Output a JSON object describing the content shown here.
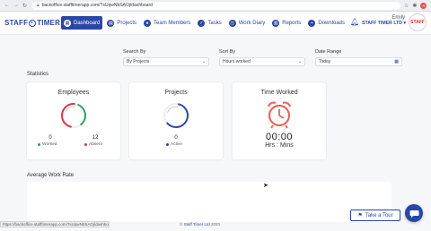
{
  "browser": {
    "url": "backoffice.stafftimerapp.com/?sUqwNbSAOj/dashboard",
    "avatar_letter": "A"
  },
  "header": {
    "logo": {
      "left": "STAFF",
      "right": "TIMER"
    },
    "menu": [
      {
        "label": "Dashboard",
        "icon": "dashboard-icon",
        "glyph": "▦",
        "active": true
      },
      {
        "label": "Projects",
        "icon": "projects-icon",
        "glyph": "▤",
        "active": false
      },
      {
        "label": "Team Members",
        "icon": "team-icon",
        "glyph": "●",
        "active": false
      },
      {
        "label": "Tasks",
        "icon": "tasks-icon",
        "glyph": "✓",
        "active": false
      },
      {
        "label": "Work Diary",
        "icon": "diary-icon",
        "glyph": "◷",
        "active": false
      },
      {
        "label": "Reports",
        "icon": "reports-icon",
        "glyph": "▥",
        "active": false
      },
      {
        "label": "Downloads",
        "icon": "downloads-icon",
        "glyph": "+",
        "active": false
      }
    ],
    "user": {
      "name": "Emily",
      "company": "STAFF TIMER LTD ▾",
      "avatar_text": "STAFF"
    }
  },
  "filters": {
    "search_by": {
      "label": "Search By",
      "value": "By Projects"
    },
    "sort_by": {
      "label": "Sort By",
      "value": "Hours worked"
    },
    "date_range": {
      "label": "Date Range",
      "value": "Today"
    }
  },
  "statistics": {
    "title": "Statistics",
    "employees": {
      "title": "Employees",
      "worked": "0",
      "worked_label": "Worked",
      "absent": "12",
      "absent_label": "Absent"
    },
    "projects": {
      "title": "Projects",
      "active": "0",
      "active_label": "Active"
    },
    "time_worked": {
      "title": "Time Worked",
      "value": "00:00",
      "unit": "Hrs : Mins"
    }
  },
  "average_work_rate": {
    "title": "Average Work Rate"
  },
  "status_url": "https://backoffice.stafftimerapp.com/?sUqwNbSAOj/dashboard",
  "footer": {
    "prefix": "©",
    "link": "Staff Timer Ltd",
    "year": "2020"
  },
  "tour": {
    "label": "Take a Tour"
  },
  "colors": {
    "brand": "#2b47a6",
    "worked": "#2aa55a",
    "absent": "#d9374b",
    "timer": "#e5675e"
  }
}
